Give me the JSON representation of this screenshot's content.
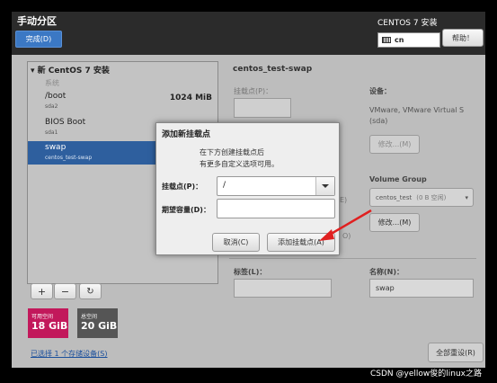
{
  "header": {
    "title": "手动分区",
    "done_label": "完成(D)",
    "product": "CENTOS 7 安装",
    "keyboard_layout": "cn",
    "help_label": "帮助！"
  },
  "left_panel": {
    "install_header": "新 CentOS 7 安装",
    "system_label": "系统",
    "partitions": [
      {
        "name": "/boot",
        "size": "1024 MiB",
        "device": "sda2"
      },
      {
        "name": "BIOS Boot",
        "size": "",
        "device": "sda1"
      },
      {
        "name": "swap",
        "size": "",
        "device": "centos_test-swap"
      }
    ],
    "add_symbol": "+",
    "remove_symbol": "−",
    "refresh_symbol": "↻"
  },
  "storage": {
    "available_label": "可用空间",
    "available_value": "18 GiB",
    "total_label": "总空间",
    "total_value": "20 GiB",
    "selected_devices_link": "已选择 1 个存储设备(S)"
  },
  "right_panel": {
    "title": "centos_test-swap",
    "mount_point_label": "挂载点(P)：",
    "device_label": "设备：",
    "device_value": "VMware, VMware Virtual S\n(sda)",
    "modify_label": "修改...(M)",
    "volume_group_label": "Volume Group",
    "volume_group_value": "centos_test",
    "volume_group_free": "(0 B 空闲)",
    "modify2_label": "修改...(M)",
    "peek_e": "E)",
    "peek_o": "O)",
    "tag_label": "标签(L)：",
    "name_label": "名称(N)：",
    "name_value": "swap",
    "reset_all_label": "全部重设(R)"
  },
  "dialog": {
    "title": "添加新挂载点",
    "description_line1": "在下方创建挂载点后",
    "description_line2": "有更多自定义选项可用。",
    "mount_point_label": "挂载点(P)：",
    "mount_point_value": "/",
    "capacity_label": "期望容量(D)：",
    "capacity_value": "",
    "cancel_label": "取消(C)",
    "add_label": "添加挂载点(A)"
  },
  "watermark": "CSDN @yellow俊的linux之路",
  "colors": {
    "header_bg": "#2b2b2b",
    "accent_blue": "#3b78c4",
    "available_pink": "#c2185b",
    "total_gray": "#555555",
    "arrow_red": "#e02020"
  }
}
